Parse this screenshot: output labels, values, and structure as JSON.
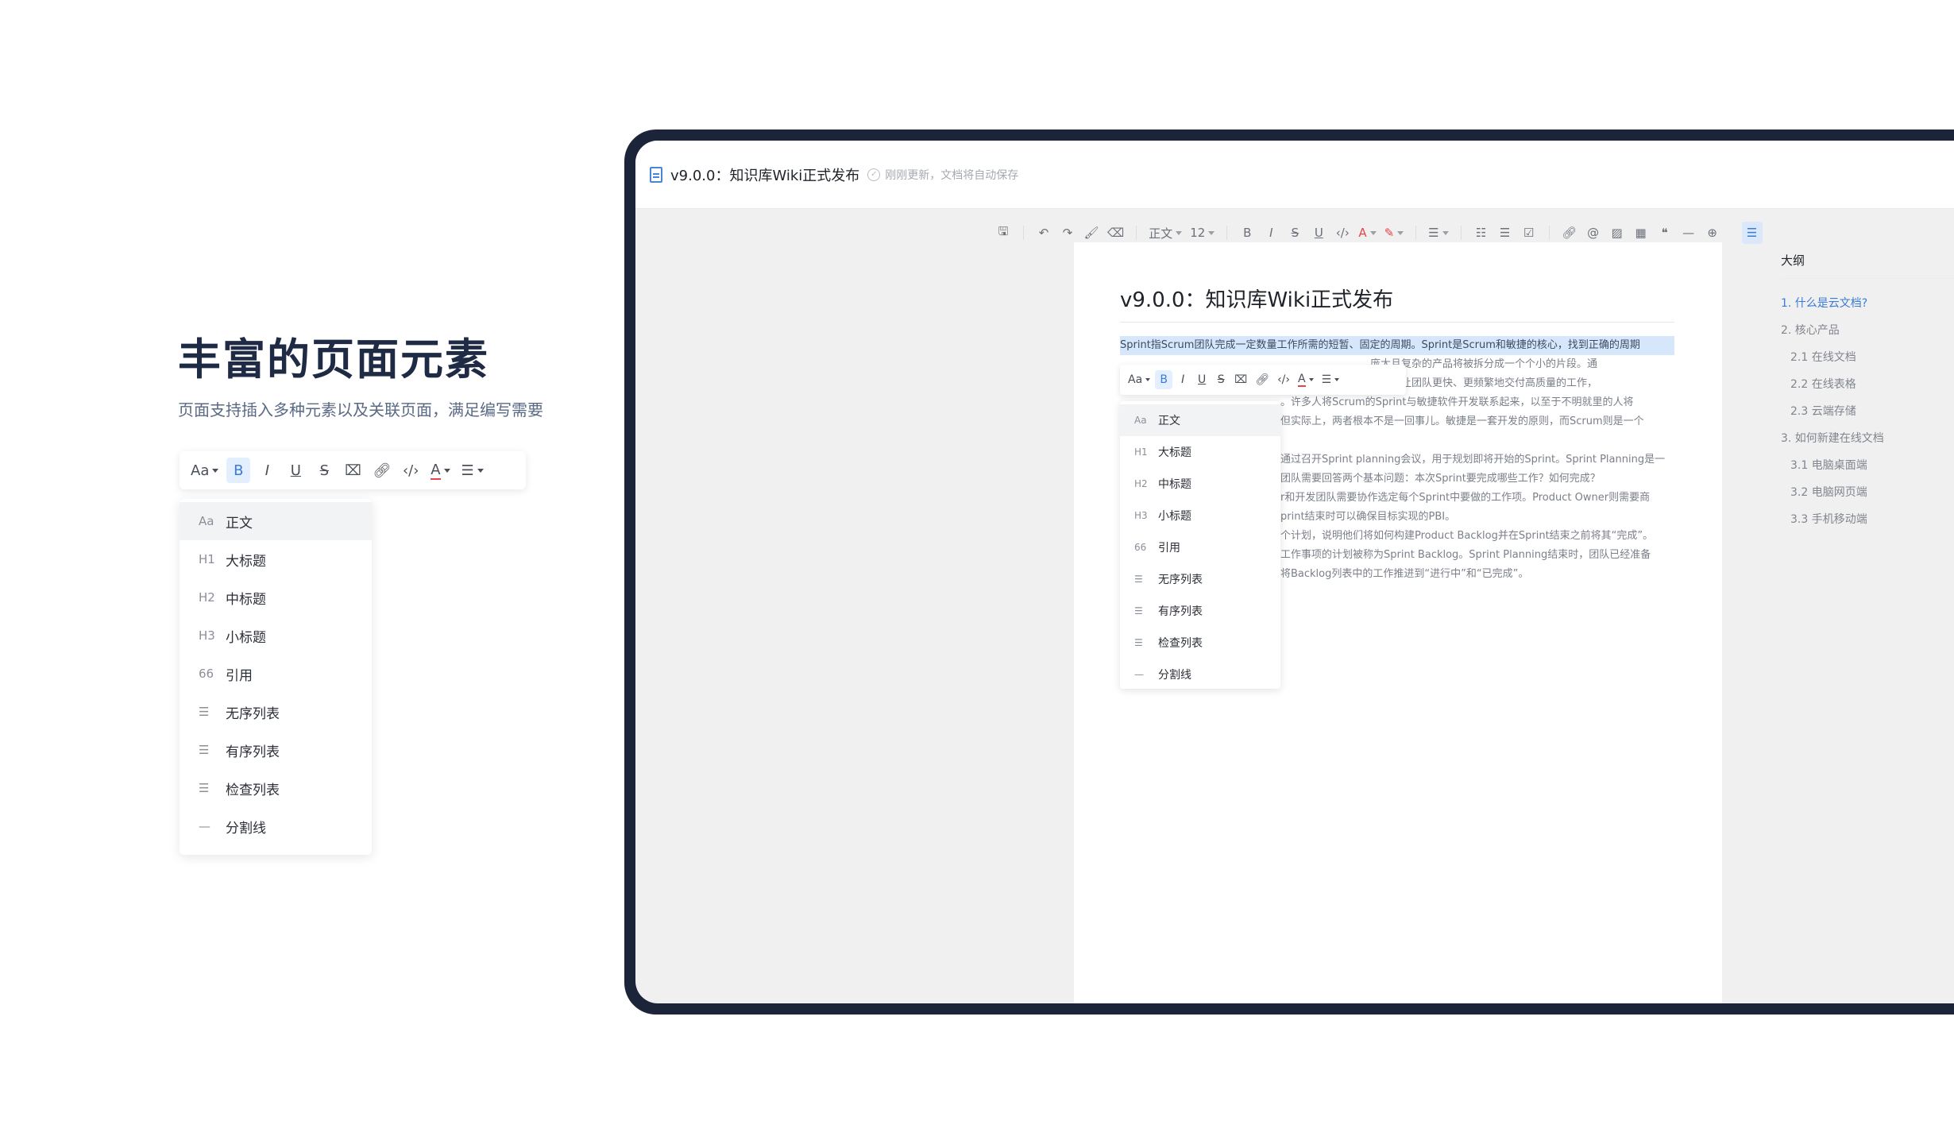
{
  "hero": {
    "title": "丰富的页面元素",
    "subtitle": "页面支持插入多种元素以及关联页面，满足编写需要"
  },
  "format_toolbar": {
    "font_style": "Aa",
    "buttons": [
      "bold-icon",
      "italic-icon",
      "underline-icon",
      "strikethrough-icon",
      "clear-format-icon",
      "link-icon",
      "code-icon",
      "font-color-icon",
      "align-icon"
    ],
    "bold": "B",
    "italic": "I",
    "underline": "U",
    "strike": "S",
    "font_color": "A",
    "active_color": "#3a7bd5"
  },
  "block_menu": {
    "items": [
      {
        "icon": "Aa",
        "label": "正文"
      },
      {
        "icon": "H1",
        "label": "大标题"
      },
      {
        "icon": "H2",
        "label": "中标题"
      },
      {
        "icon": "H3",
        "label": "小标题"
      },
      {
        "icon": "66",
        "label": "引用"
      },
      {
        "icon": "☰",
        "label": "无序列表"
      },
      {
        "icon": "☰",
        "label": "有序列表"
      },
      {
        "icon": "☰",
        "label": "检查列表"
      },
      {
        "icon": "—",
        "label": "分割线"
      }
    ]
  },
  "app": {
    "title": "v9.0.0：知识库Wiki正式发布",
    "save_status": "刚刚更新，文档将自动保存",
    "toolbar": {
      "text_style": "正文",
      "font_size": "12"
    }
  },
  "doc": {
    "heading": "v9.0.0：知识库Wiki正式发布",
    "selected_line": "Sprint指Scrum团队完成一定数量工作所需的短暂、固定的周期。Sprint是Scrum和敏捷的核心，找到正确的周期",
    "lines": [
      "，庞大且复杂的产品将被拆分成一个个小的片段。通",
      "于管理，让团队更快、更频繁地交付高质量的工作，",
      "。许多人将Scrum的Sprint与敏捷软件开发联系起来，以至于不明就里的人将",
      "但实际上，两者根本不是一回事儿。敏捷是一套开发的原则，而Scrum则是一个"
    ],
    "lines2": [
      "通过召开Sprint planning会议，用于规划即将开始的Sprint。Sprint Planning是一",
      "团队需要回答两个基本问题：本次Sprint要完成哪些工作？如何完成？",
      "r和开发团队需要协作选定每个Sprint中要做的工作项。Product Owner则需要商",
      "print结束时可以确保目标实现的PBI。",
      "个计划，说明他们将如何构建Product Backlog并在Sprint结束之前将其“完成”。",
      "工作事项的计划被称为Sprint Backlog。Sprint Planning结束时，团队已经准备",
      "将Backlog列表中的工作推进到“进行中”和“已完成”。"
    ]
  },
  "outline": {
    "title": "大纲",
    "items": [
      {
        "label": "1. 什么是云文档?",
        "level": 1,
        "active": true
      },
      {
        "label": "2. 核心产品",
        "level": 1
      },
      {
        "label": "2.1 在线文档",
        "level": 2
      },
      {
        "label": "2.2 在线表格",
        "level": 2
      },
      {
        "label": "2.3 云端存储",
        "level": 2
      },
      {
        "label": "3. 如何新建在线文档",
        "level": 1
      },
      {
        "label": "3.1 电脑桌面端",
        "level": 2
      },
      {
        "label": "3.2 电脑网页端",
        "level": 2
      },
      {
        "label": "3.3 手机移动端",
        "level": 2
      }
    ]
  }
}
